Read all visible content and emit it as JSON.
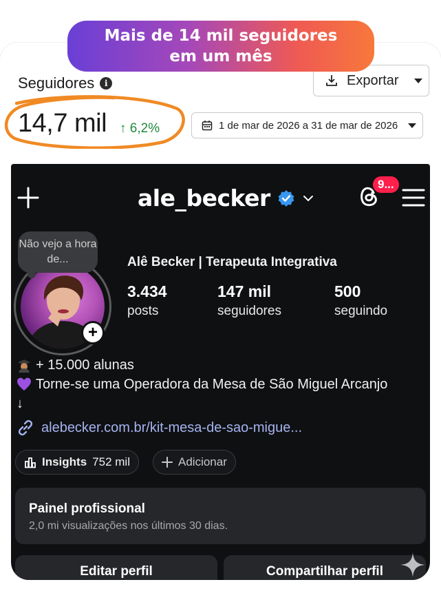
{
  "banner": {
    "line1": "Mais de 14 mil seguidores",
    "line2": "em um mês"
  },
  "analytics": {
    "title": "Seguidores",
    "followers": "14,7 mil",
    "growth": "↑ 6,2%",
    "export_label": "Exportar",
    "date_range": "1 de mar de 2026 a 31 de mar de 2026"
  },
  "instagram": {
    "username": "ale_becker",
    "notification_count": "9...",
    "note": "Não vejo a hora de...",
    "display_name": "Alê Becker | Terapeuta Integrativa",
    "stats": [
      {
        "value": "3.434",
        "label": "posts"
      },
      {
        "value": "147 mil",
        "label": "seguidores"
      },
      {
        "value": "500",
        "label": "seguindo"
      }
    ],
    "bio": [
      "+ 15.000 alunas",
      "Torne-se uma Operadora da Mesa de São Miguel Arcanjo",
      "↓"
    ],
    "link": "alebecker.com.br/kit-mesa-de-sao-migue...",
    "insights_label": "Insights",
    "insights_value": "752 mil",
    "add_label": "Adicionar",
    "panel_title": "Painel profissional",
    "panel_sub": "2,0 mi visualizações nos últimos 30 dias.",
    "edit_profile": "Editar perfil",
    "share_profile": "Compartilhar perfil"
  },
  "colors": {
    "growth": "#1e8a3c",
    "badge": "#ff1f4b",
    "link": "#a5b4f0",
    "ring": "#f08a24"
  }
}
